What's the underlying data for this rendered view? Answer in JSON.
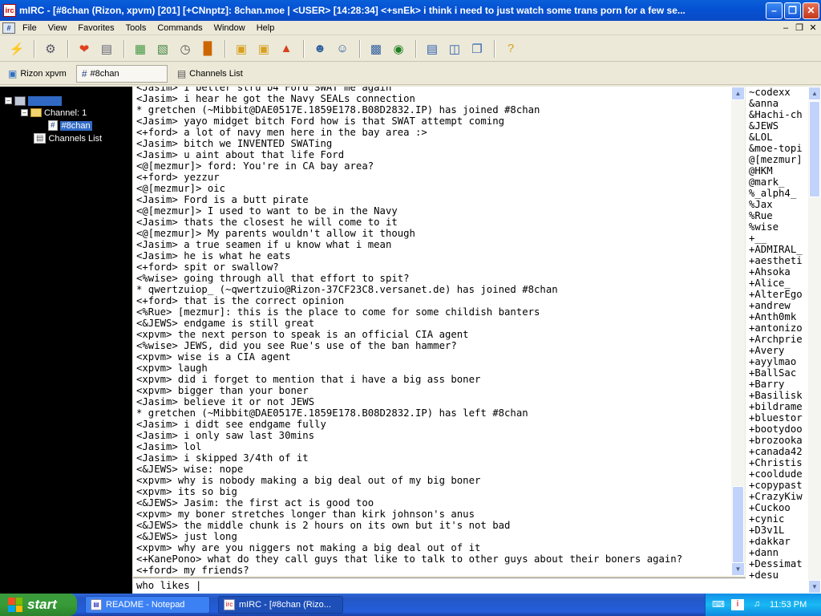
{
  "window": {
    "title": "mIRC - [#8chan (Rizon, xpvm) [201] [+CNnptz]: 8chan.moe  |  <USER> [14:28:34] <+snEk> i think i need to just watch some trans porn for a few se..."
  },
  "menu": [
    "File",
    "View",
    "Favorites",
    "Tools",
    "Commands",
    "Window",
    "Help"
  ],
  "switchbar": {
    "items": [
      {
        "label": "Rizon xpvm",
        "active": false
      },
      {
        "label": "#8chan",
        "active": true
      },
      {
        "label": "Channels List",
        "active": false
      }
    ]
  },
  "tree": {
    "channel_folder": "Channel: 1",
    "channel": "#8chan",
    "channels_list": "Channels List"
  },
  "chat": {
    "lines": [
      "<Jasim> I better stru b4 Ford SWAT me again",
      "<Jasim> i hear he got the Navy SEALs connection",
      "* gretchen (~Mibbit@DAE0517E.1859E178.B08D2832.IP) has joined #8chan",
      "<Jasim> yayo midget bitch Ford how is that SWAT attempt coming",
      "<+ford> a lot of navy men here in the bay area :>",
      "<Jasim> bitch we INVENTED SWATing",
      "<Jasim> u aint about that life Ford",
      "<@[mezmur]> ford: You're in CA bay area?",
      "<+ford> yezzur",
      "<@[mezmur]> oic",
      "<Jasim> Ford is a butt pirate",
      "<@[mezmur]> I used to want to be in the Navy",
      "<Jasim> thats the closest he will come to it",
      "<@[mezmur]> My parents wouldn't allow it though",
      "<Jasim> a true seamen if u know what i mean",
      "<Jasim> he is what he eats",
      "<+ford> spit or swallow?",
      "<%wise> going through all that effort to spit?",
      "* qwertzuiop_ (~qwertzuio@Rizon-37CF23C8.versanet.de) has joined #8chan",
      "<+ford> that is the correct opinion",
      "<%Rue> [mezmur]: this is the place to come for some childish banters",
      "<&JEWS> endgame is still great",
      "<xpvm> the next person to speak is an official CIA agent",
      "<%wise> JEWS, did you see Rue's use of the ban hammer?",
      "<xpvm> wise is a CIA agent",
      "<xpvm> laugh",
      "<xpvm> did i forget to mention that i have a big ass boner",
      "<xpvm> bigger than your boner",
      "<Jasim> believe it or not JEWS",
      "* gretchen (~Mibbit@DAE0517E.1859E178.B08D2832.IP) has left #8chan",
      "<Jasim> i didt see endgame fully",
      "<Jasim> i only saw last 30mins",
      "<Jasim> lol",
      "<Jasim> i skipped 3/4th of it",
      "<&JEWS> wise: nope",
      "<xpvm> why is nobody making a big deal out of my big boner",
      "<xpvm> its so big",
      "<&JEWS> Jasim: the first act is good too",
      "<xpvm> my boner stretches longer than kirk johnson's anus",
      "<&JEWS> the middle chunk is 2 hours on its own but it's not bad",
      "<&JEWS> just long",
      "<xpvm> why are you niggers not making a big deal out of it",
      "<+KanePono> what do they call guys that like to talk to other guys about their boners again?",
      "<+ford> my friends?"
    ]
  },
  "input": {
    "value": "who likes |"
  },
  "nicklist": [
    "~codexx",
    "&anna",
    "&Hachi-ch",
    "&JEWS",
    "&LOL",
    "&moe-topi",
    "@[mezmur]",
    "@HKM",
    "@mark_",
    "%_alph4_",
    "%Jax",
    "%Rue",
    "%wise",
    "+__",
    "+ADMIRAL_",
    "+aestheti",
    "+Ahsoka",
    "+Alice_",
    "+AlterEgo",
    "+andrew",
    "+Anth0mk",
    "+antonizo",
    "+Archprie",
    "+Avery",
    "+ayylmao",
    "+BallSac",
    "+Barry",
    "+Basilisk",
    "+bildrame",
    "+bluestor",
    "+bootydoo",
    "+brozooka",
    "+canada42",
    "+Christis",
    "+cooldude",
    "+copypast",
    "+CrazyKiw",
    "+Cuckoo",
    "+cynic",
    "+D3v1L",
    "+dakkar",
    "+dann",
    "+Dessimat",
    "+desu"
  ],
  "taskbar": {
    "start": "start",
    "tasks": [
      {
        "label": "README - Notepad",
        "active": false
      },
      {
        "label": "mIRC - [#8chan (Rizo...",
        "active": true
      }
    ],
    "clock": "11:53 PM"
  }
}
